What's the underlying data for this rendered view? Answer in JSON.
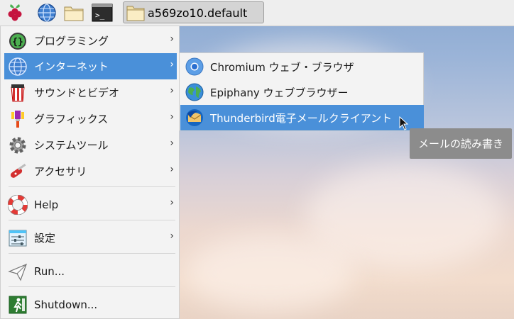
{
  "taskbar": {
    "launchers": [
      {
        "icon": "raspberry-menu-icon"
      },
      {
        "icon": "web-browser-icon"
      },
      {
        "icon": "file-manager-icon"
      },
      {
        "icon": "terminal-icon",
        "glyph": ">_"
      }
    ],
    "window_title": "a569zo10.default"
  },
  "main_menu": {
    "items": [
      {
        "label": "プログラミング",
        "icon": "programming-icon"
      },
      {
        "label": "インターネット",
        "icon": "internet-globe-icon"
      },
      {
        "label": "サウンドとビデオ",
        "icon": "sound-video-icon"
      },
      {
        "label": "グラフィックス",
        "icon": "graphics-icon"
      },
      {
        "label": "システムツール",
        "icon": "system-tools-icon"
      },
      {
        "label": "アクセサリ",
        "icon": "accessories-icon"
      },
      {
        "label": "Help",
        "icon": "help-lifebuoy-icon"
      },
      {
        "label": "設定",
        "icon": "settings-icon"
      },
      {
        "label": "Run...",
        "icon": "run-paper-plane-icon"
      },
      {
        "label": "Shutdown...",
        "icon": "shutdown-exit-icon"
      }
    ],
    "arrow": "›"
  },
  "sub_menu": {
    "items": [
      {
        "label": "Chromium ウェブ・ブラウザ",
        "icon": "chromium-icon"
      },
      {
        "label": "Epiphany ウェブブラウザー",
        "icon": "epiphany-icon"
      },
      {
        "label": "Thunderbird電子メールクライアント",
        "icon": "thunderbird-icon"
      }
    ]
  },
  "tooltip": "メールの読み書き",
  "colors": {
    "accent": "#4a90d9",
    "menu_bg": "#f3f3f3",
    "tooltip_bg": "#8c8c8c"
  }
}
